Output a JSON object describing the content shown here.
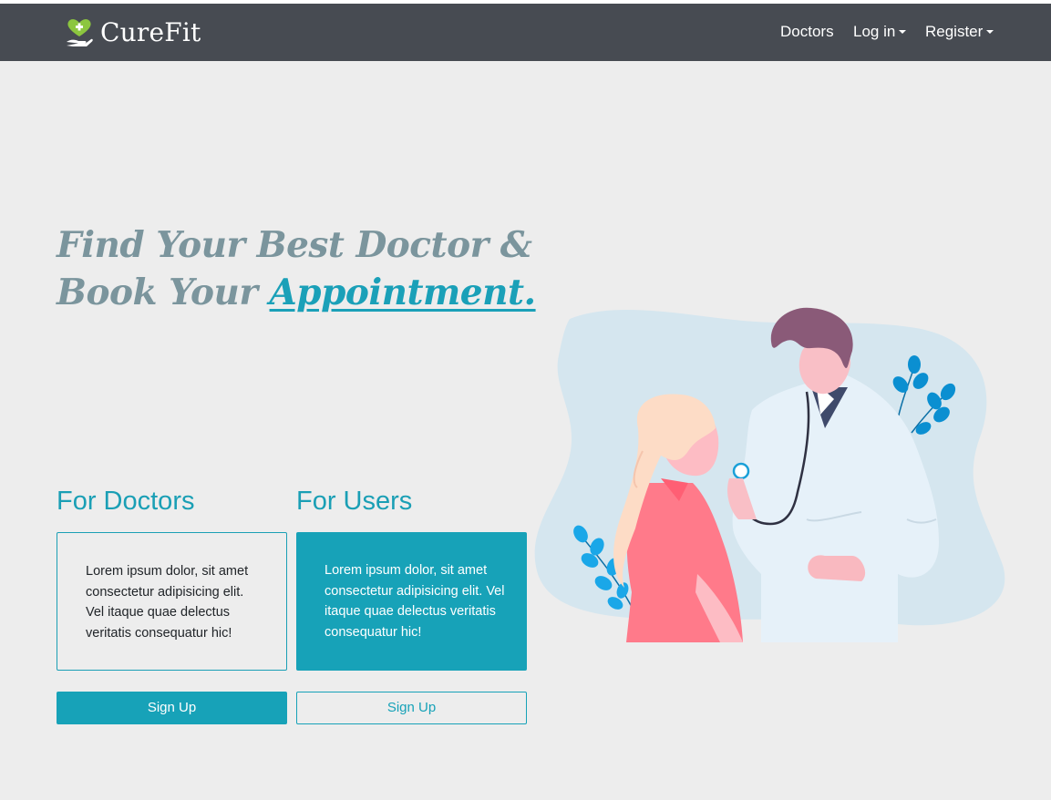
{
  "navbar": {
    "brand": "CureFit",
    "links": [
      {
        "label": "Doctors"
      },
      {
        "label": "Log in",
        "dropdown": true
      },
      {
        "label": "Register",
        "dropdown": true
      }
    ]
  },
  "hero": {
    "line1": "Find Your Best Doctor &",
    "line2_prefix": "Book Your ",
    "line2_accent": "Appointment."
  },
  "doctors": {
    "heading": "For Doctors",
    "text": "Lorem ipsum dolor, sit amet consectetur adipisicing elit. Vel itaque quae delectus veritatis consequatur hic!",
    "button": "Sign Up"
  },
  "users": {
    "heading": "For Users",
    "text": "Lorem ipsum dolor, sit amet consectetur adipisicing elit. Vel itaque quae delectus veritatis consequatur hic!",
    "button": "Sign Up"
  },
  "icons": {
    "logo": "heart-hand-logo-icon",
    "caret": "caret-down-icon",
    "illustration": "doctor-patient-illustration"
  },
  "colors": {
    "navbar_bg": "#474b52",
    "page_bg": "#ededed",
    "accent": "#17a2b8",
    "hero_text": "#7b959d"
  }
}
